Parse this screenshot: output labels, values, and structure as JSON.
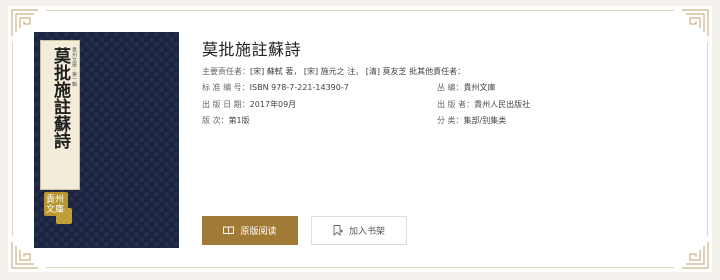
{
  "book": {
    "title": "莫批施註蘇詩",
    "cover": {
      "title": "莫批施註蘇詩",
      "subtitle": "貴州文庫 · 第一輯",
      "volume": "第一冊",
      "stamp": "貴州文庫"
    },
    "responsibility": {
      "label": "主要责任者：",
      "value": "[宋] 蘇軾 著， [宋] 施元之 注， [清] 莫友芝 批其他責任者："
    },
    "fields": [
      {
        "label": "标 准 编 号：",
        "value": "ISBN 978-7-221-14390-7"
      },
      {
        "label": "丛        编：",
        "value": "貴州文庫"
      },
      {
        "label": "出 版 日 期：",
        "value": "2017年09月"
      },
      {
        "label": "出   版   者：",
        "value": "貴州人民出版社"
      },
      {
        "label": "版           次：",
        "value": "第1版"
      },
      {
        "label": "分        类：",
        "value": "集部/别集类"
      }
    ]
  },
  "actions": {
    "read_label": "原版阅读",
    "shelf_label": "加入书架",
    "read_icon": "open-book-icon",
    "shelf_icon": "bookmark-add-icon"
  },
  "colors": {
    "accent": "#a17a35",
    "cover_bg": "#1b2440",
    "frame": "#e3d6c0"
  }
}
